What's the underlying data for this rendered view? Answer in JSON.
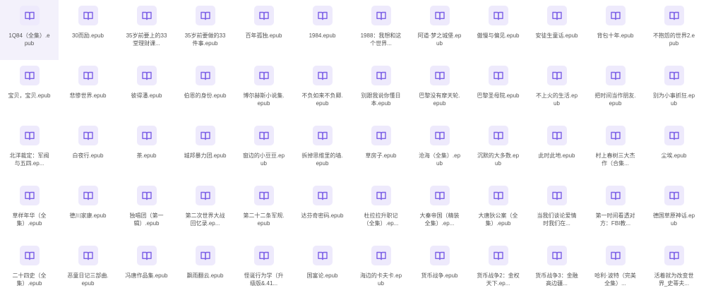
{
  "file_icon": "epub-book-icon",
  "accent_color": "#7b5fe6",
  "files": [
    "1Q84（全集）.epub",
    "30而励.epub",
    "35岁前要上的33堂理财课...",
    "35岁前要做的33件事.epub",
    "百年孤独.epub",
    "1984.epub",
    "1988：我想和这个世界...",
    "阿道·梦之城堡.epub",
    "傲慢与偏见.epub",
    "安徒生童话.epub",
    "背包十年.epub",
    "不抱怨的世界2.epub",
    "宝贝，宝贝.epub",
    "悲惨世界.epub",
    "彼得潘.epub",
    "伯恩的身份.epub",
    "博尔赫斯小说集.epub",
    "不负如来不负卿.epub",
    "别跟我说你懂日本.epub",
    "巴黎没有摩天轮.epub",
    "巴黎圣母院.epub",
    "不上火的生活.epub",
    "把时间当作朋友.epub",
    "别为小事抓狂.epub",
    "北洋裁定：军阀与五四.ep...",
    "白夜行.epub",
    "茶.epub",
    "城邦暴力团.epub",
    "窗边的小豆豆.epub",
    "拆掉思维里的墙.epub",
    "草房子.epub",
    "沧海（全集）.epub",
    "沉默的大多数.epub",
    "此时此地.epub",
    "村上春树三大杰作（合集...",
    "尘埃.epub",
    "草样年华（全集）.epub",
    "德川家康.epub",
    "独唱团（第一辑）.epub",
    "第二次世界大战回忆录.ep...",
    "第二十二条军规.epub",
    "达芬奇密码.epub",
    "杜拉拉升职记（全集）.ep...",
    "大秦帝国（精装全集）.ep...",
    "大唐狄公案（全集）.epub",
    "当我们谈论爱情时我们在...",
    "第一时间看透对方：FBI教...",
    "德国草原神话.epub",
    "二十四史（全集）.epub",
    "恶童日记三部曲.epub",
    "冯唐作品集.epub",
    "飘雨翻云.epub",
    "怪诞行为学（升级版&.41...",
    "国富论.epub",
    "海边的卡夫卡.epub",
    "货币战争.epub",
    "货币战争2：金权天下.ep...",
    "货币战争3：金融高边疆...",
    "哈利·波特（完美全集）...",
    "活着就为改变世界_史蒂夫..."
  ]
}
